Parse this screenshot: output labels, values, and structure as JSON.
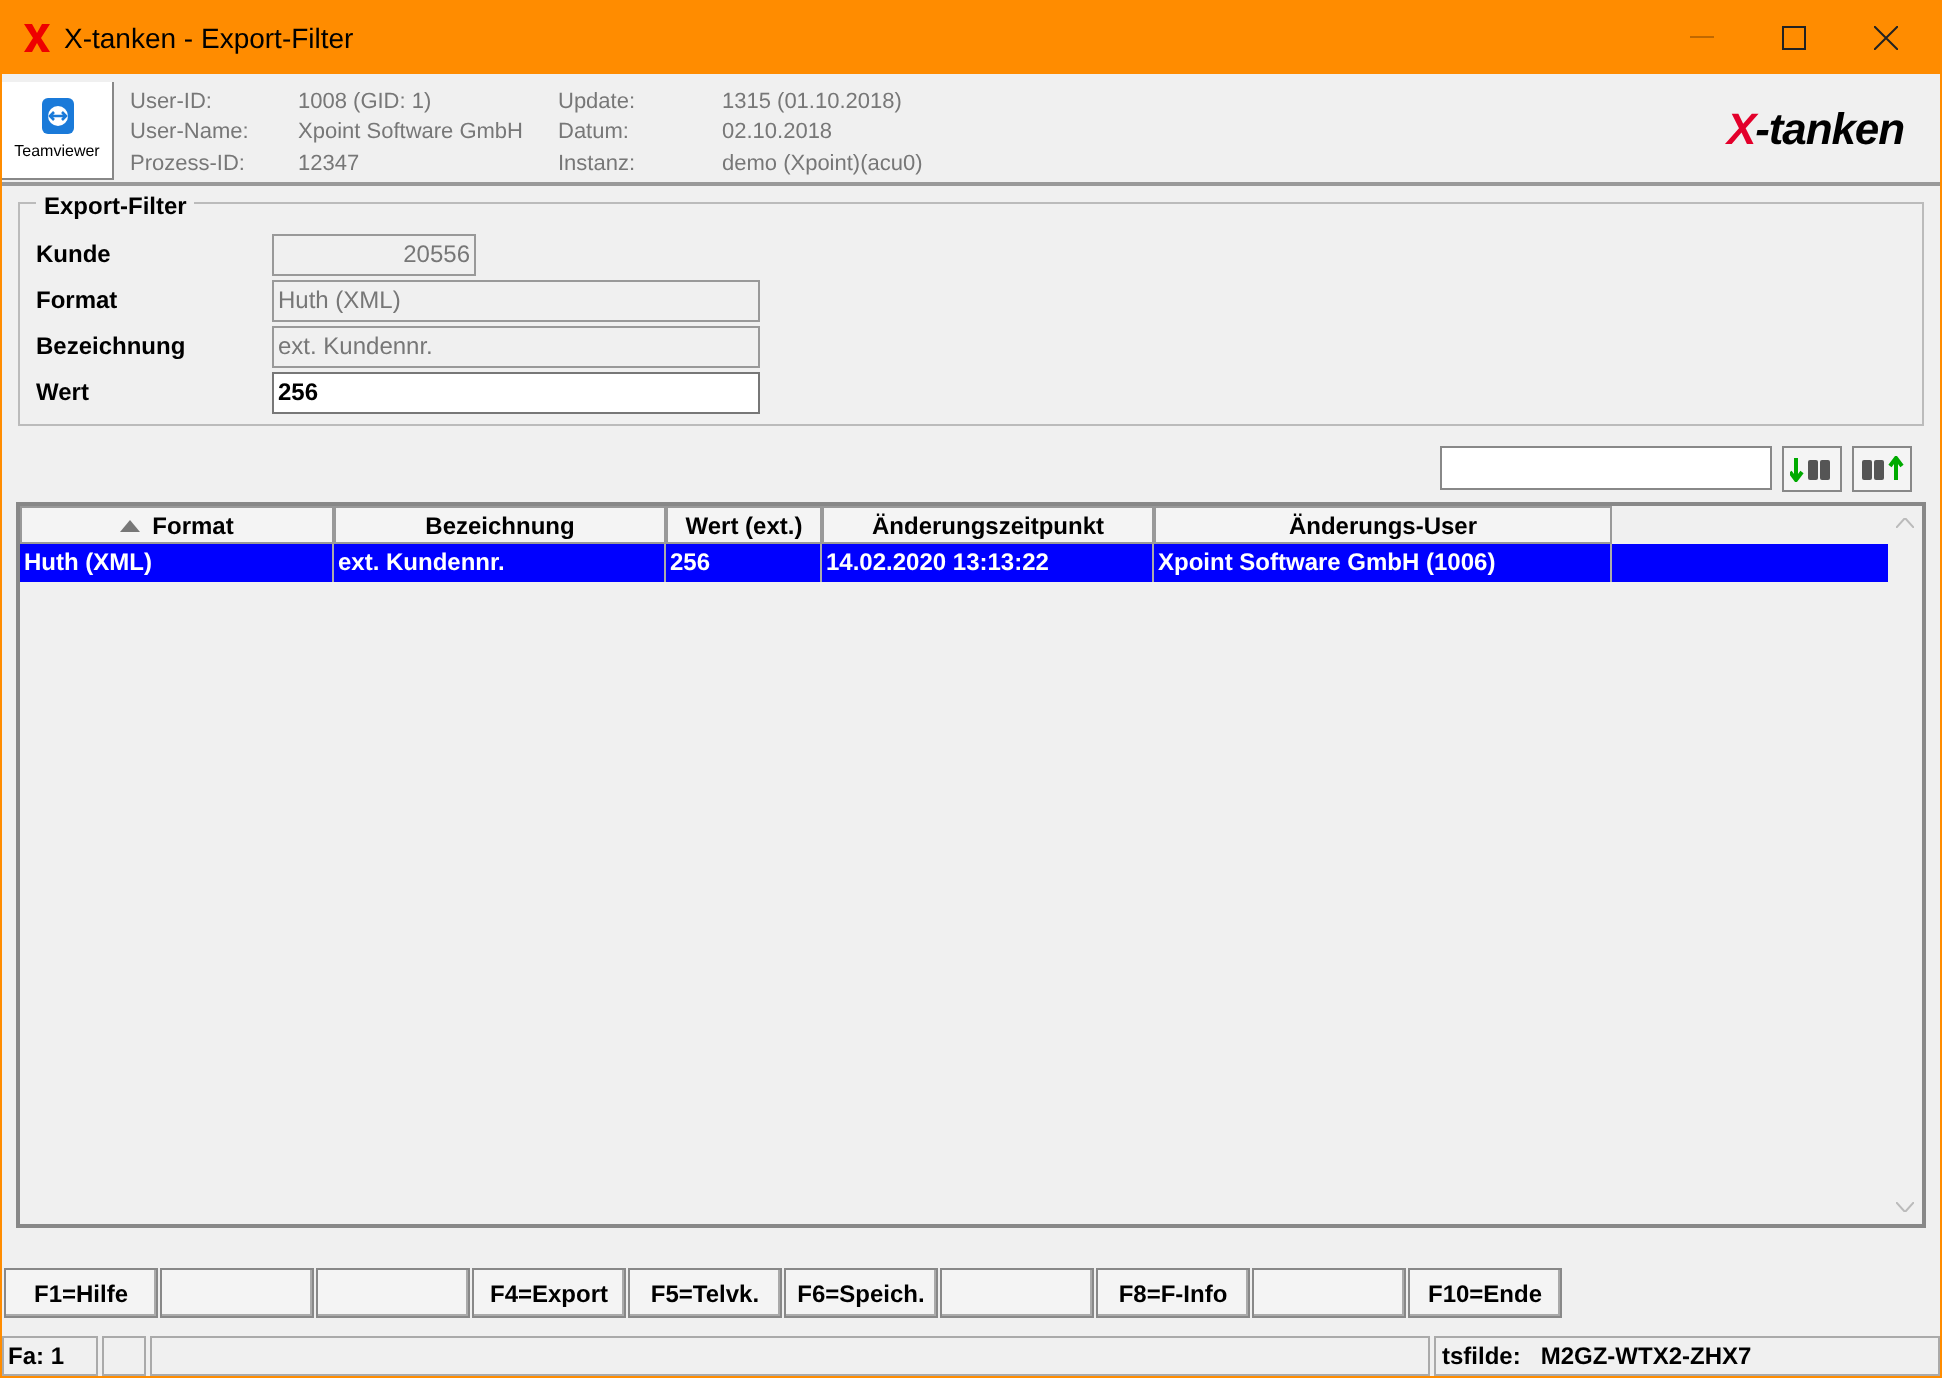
{
  "window": {
    "title": "X-tanken - Export-Filter"
  },
  "header": {
    "teamviewer_label": "Teamviewer",
    "info": [
      {
        "label": "User-ID:",
        "value": "1008 (GID: 1)"
      },
      {
        "label": "User-Name:",
        "value": "Xpoint Software GmbH"
      },
      {
        "label": "Prozess-ID:",
        "value": "12347"
      },
      {
        "label": "Update:",
        "value": "1315 (01.10.2018)"
      },
      {
        "label": "Datum:",
        "value": "02.10.2018"
      },
      {
        "label": "Instanz:",
        "value": "demo (Xpoint)(acu0)"
      }
    ],
    "logo_mark": "X",
    "logo_text": "-tanken"
  },
  "filter": {
    "title": "Export-Filter",
    "fields": [
      {
        "label": "Kunde",
        "value": "20556",
        "disabled": true,
        "kind": "short"
      },
      {
        "label": "Format",
        "value": "Huth (XML)",
        "disabled": true,
        "kind": "long"
      },
      {
        "label": "Bezeichnung",
        "value": "ext. Kundennr.",
        "disabled": true,
        "kind": "long"
      },
      {
        "label": "Wert",
        "value": "256",
        "disabled": false,
        "kind": "long"
      }
    ]
  },
  "table": {
    "columns": [
      {
        "label": "Format",
        "sorted": true
      },
      {
        "label": "Bezeichnung",
        "sorted": false
      },
      {
        "label": "Wert (ext.)",
        "sorted": false
      },
      {
        "label": "Änderungszeitpunkt",
        "sorted": false
      },
      {
        "label": "Änderungs-User",
        "sorted": false
      }
    ],
    "rows": [
      {
        "selected": true,
        "cells": [
          "Huth (XML)",
          "ext. Kundennr.",
          "256",
          "14.02.2020 13:13:22",
          "Xpoint Software GmbH (1006)"
        ]
      }
    ]
  },
  "function_keys": [
    {
      "kind": "key",
      "label": "F1=Hilfe"
    },
    {
      "kind": "blank"
    },
    {
      "kind": "blank"
    },
    {
      "kind": "key",
      "label": "F4=Export"
    },
    {
      "kind": "key",
      "label": "F5=Telvk."
    },
    {
      "kind": "key",
      "label": "F6=Speich."
    },
    {
      "kind": "blank"
    },
    {
      "kind": "key",
      "label": "F8=F-Info"
    },
    {
      "kind": "blank"
    },
    {
      "kind": "key",
      "label": "F10=Ende"
    }
  ],
  "status_bar": {
    "left": "Fa: 1",
    "label": "tsfilde:",
    "value": "M2GZ-WTX2-ZHX7"
  }
}
